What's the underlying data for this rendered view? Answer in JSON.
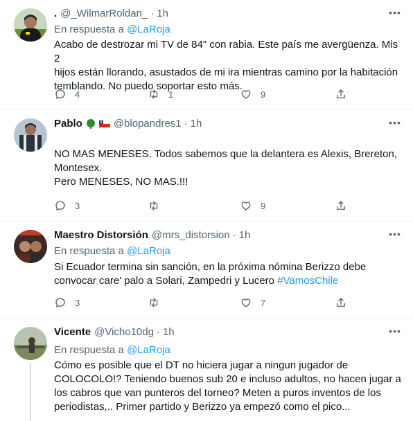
{
  "tweets": [
    {
      "name": ".",
      "handle": "@_WilmarRoldan_",
      "dot": "·",
      "time": "1h",
      "reply_prefix": "En respuesta a",
      "reply_mention": "@LaRoja",
      "text_lines": [
        "Acabo de destrozar mi TV de 84\" con rabia. Este país me avergüenza. Mis 2",
        "hijos están llorando, asustados de mi ira mientras camino por la habitación",
        "temblando. No puedo soportar esto más."
      ],
      "replies": "4",
      "retweets": "1",
      "likes": "9",
      "avatar_color": "#6b8e3a"
    },
    {
      "name": "Pablo",
      "name_emojis": [
        "tree-emoji",
        "chile-flag-emoji"
      ],
      "handle": "@blopandres1",
      "dot": "·",
      "time": "1h",
      "text_lines": [
        "NO MAS MENESES. Todos sabemos que la delantera es Alexis, Brereton,",
        "Montesex.",
        "Pero MENESES, NO MAS.!!!"
      ],
      "replies": "3",
      "retweets": "",
      "likes": "9",
      "avatar_color": "#4a5a6a"
    },
    {
      "name": "Maestro Distorsión",
      "handle": "@mrs_distorsion",
      "dot": "·",
      "time": "1h",
      "reply_prefix": "En respuesta a",
      "reply_mention": "@LaRoja",
      "text_lines": [
        "Si Ecuador termina sin sanción, en la próxima nómina Berizzo debe",
        "convocar care' palo a Solari, Zampedri y Lucero"
      ],
      "hashtag": "#VamosChile",
      "replies": "3",
      "retweets": "",
      "likes": "7",
      "avatar_color": "#8a3a2a"
    },
    {
      "name": "Vicente",
      "handle": "@Vicho10dg",
      "dot": "·",
      "time": "1h",
      "reply_prefix": "En respuesta a",
      "reply_mention": "@LaRoja",
      "text_lines": [
        "Cómo es posible que el DT no hiciera jugar a ningun jugador de",
        "COLOCOLO!? Teniendo buenos sub 20 e incluso adultos, no hacen jugar a",
        "los cabros que van punteros del torneo? Meten a puros inventos de los",
        "periodistas,.. Primer partido y Berizzo ya empezó como el pico..."
      ],
      "avatar_color": "#7a8a5a"
    }
  ],
  "colors": {
    "link": "#1d9bf0",
    "secondary": "#536471",
    "text": "#0f1419",
    "divider": "#eff3f4"
  }
}
